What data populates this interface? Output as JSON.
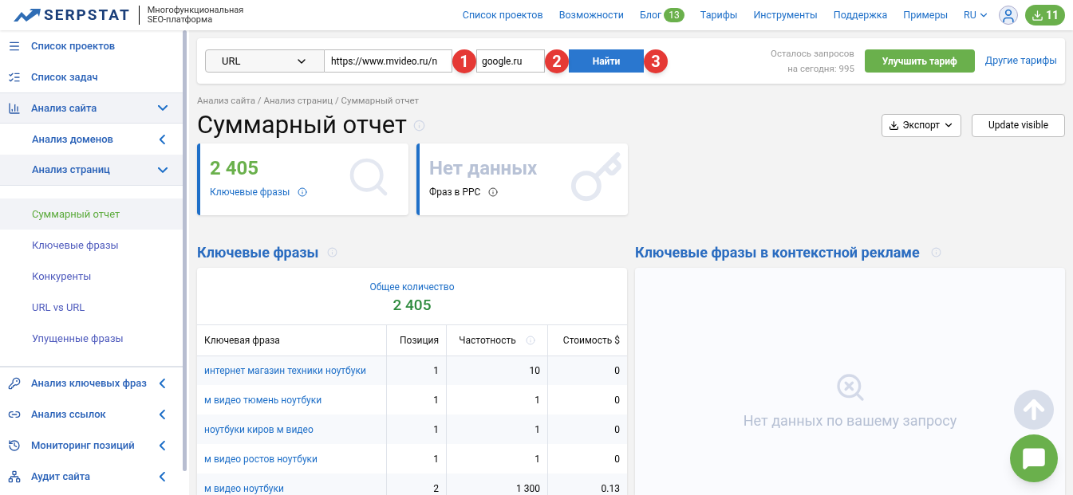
{
  "header": {
    "logo": "SERPSTAT",
    "tagline_lines": [
      "Многофункциональная",
      "SEO-платформа"
    ],
    "nav": [
      {
        "label": "Список проектов"
      },
      {
        "label": "Возможности"
      },
      {
        "label": "Блог",
        "badge": "13"
      },
      {
        "label": "Тарифы"
      },
      {
        "label": "Инструменты"
      },
      {
        "label": "Поддержка"
      },
      {
        "label": "Примеры"
      }
    ],
    "language": "RU",
    "downloads": "11"
  },
  "sidebar": {
    "items": [
      {
        "label": "Список проектов"
      },
      {
        "label": "Список задач"
      },
      {
        "label": "Анализ сайта",
        "expanded": true,
        "children": [
          {
            "label": "Анализ доменов",
            "expanded": false
          },
          {
            "label": "Анализ страниц",
            "expanded": true,
            "children": [
              {
                "label": "Суммарный отчет",
                "selected": true
              },
              {
                "label": "Ключевые фразы",
                "selected": false
              },
              {
                "label": "Конкуренты",
                "selected": false
              },
              {
                "label": "URL vs URL",
                "selected": false
              },
              {
                "label": "Упущенные фразы",
                "selected": false
              }
            ]
          }
        ]
      },
      {
        "label": "Анализ ключевых фраз",
        "expanded": false
      },
      {
        "label": "Анализ ссылок",
        "expanded": false
      },
      {
        "label": "Мониторинг позиций",
        "expanded": false
      },
      {
        "label": "Аудит сайта",
        "expanded": false
      }
    ]
  },
  "search": {
    "type": "URL",
    "url_value": "https://www.mvideo.ru/n",
    "url_step": "1",
    "engine_value": "google.ru",
    "engine_step": "2",
    "button": "Найти",
    "button_step": "3",
    "limit_lines": [
      "Осталось запросов",
      "на сегодня: 995"
    ],
    "upgrade": "Улучшить тариф",
    "other_plans": "Другие тарифы"
  },
  "breadcrumb": "Анализ сайта / Анализ страниц / Суммарный отчет",
  "title": "Суммарный отчет",
  "actions": {
    "export": "Экспорт",
    "update": "Update visible"
  },
  "summary_cards": [
    {
      "value": "2 405",
      "label": "Ключевые фразы",
      "has_data": true
    },
    {
      "value": "Нет данных",
      "label": "Фраз в PPC",
      "has_data": false
    }
  ],
  "keywords": {
    "title": "Ключевые фразы",
    "total_label": "Общее количество",
    "total": "2 405",
    "columns": [
      {
        "label": "Ключевая фраза",
        "info": false
      },
      {
        "label": "Позиция",
        "info": false
      },
      {
        "label": "Частотность",
        "info": true
      },
      {
        "label": "Стоимость $",
        "info": false
      }
    ],
    "rows": [
      [
        "интернет магазин техники ноутбуки",
        "1",
        "10",
        "0"
      ],
      [
        "м видео тюмень ноутбуки",
        "1",
        "1",
        "0"
      ],
      [
        "ноутбуки киров м видео",
        "1",
        "1",
        "0"
      ],
      [
        "м видео ростов ноутбуки",
        "1",
        "1",
        "0"
      ],
      [
        "м видео ноутбуки",
        "2",
        "1 300",
        "0.13"
      ]
    ]
  },
  "ppc": {
    "title": "Ключевые фразы в контекстной рекламе",
    "empty": "Нет данных по вашему запросу"
  }
}
